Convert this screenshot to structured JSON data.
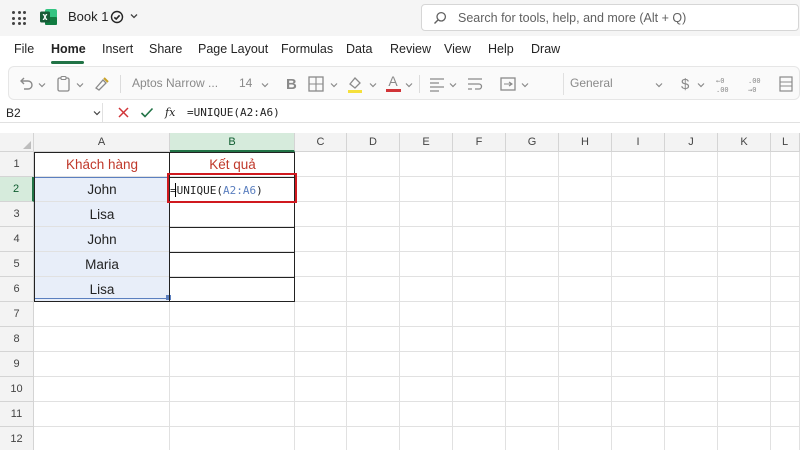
{
  "titlebar": {
    "book_title": "Book 1",
    "search_placeholder": "Search for tools, help, and more (Alt + Q)"
  },
  "tabs": [
    {
      "label": "File",
      "active": false
    },
    {
      "label": "Home",
      "active": true
    },
    {
      "label": "Insert",
      "active": false
    },
    {
      "label": "Share",
      "active": false
    },
    {
      "label": "Page Layout",
      "active": false
    },
    {
      "label": "Formulas",
      "active": false
    },
    {
      "label": "Data",
      "active": false
    },
    {
      "label": "Review",
      "active": false
    },
    {
      "label": "View",
      "active": false
    },
    {
      "label": "Help",
      "active": false
    },
    {
      "label": "Draw",
      "active": false
    }
  ],
  "ribbon": {
    "font_name": "Aptos Narrow ...",
    "font_size": "14",
    "number_format": "General",
    "bold_label": "B",
    "font_color_label": "A",
    "currency_symbol": "$"
  },
  "formula_bar": {
    "name_box": "B2",
    "fx_label": "fx",
    "formula": "=UNIQUE(A2:A6)"
  },
  "grid": {
    "columns": [
      "A",
      "B",
      "C",
      "D",
      "E",
      "F",
      "G",
      "H",
      "I",
      "J",
      "K",
      "L"
    ],
    "rows": [
      "1",
      "2",
      "3",
      "4",
      "5",
      "6",
      "7",
      "8",
      "9",
      "10",
      "11",
      "12"
    ],
    "selected_column": "B",
    "selected_row": "2",
    "cells": {
      "A1": "Khách hàng",
      "B1": "Kết quả",
      "A2": "John",
      "A3": "Lisa",
      "A4": "John",
      "A5": "Maria",
      "A6": "Lisa"
    },
    "editing_cell": {
      "prefix": "=UNIQUE(",
      "ref": "A2:A6",
      "suffix": ")"
    }
  },
  "colors": {
    "accent": "#217346",
    "header_text": "#c0392b",
    "highlight_box": "#d0191f",
    "range_ref": "#5b7fbf",
    "range_fill": "#e8eef9"
  }
}
